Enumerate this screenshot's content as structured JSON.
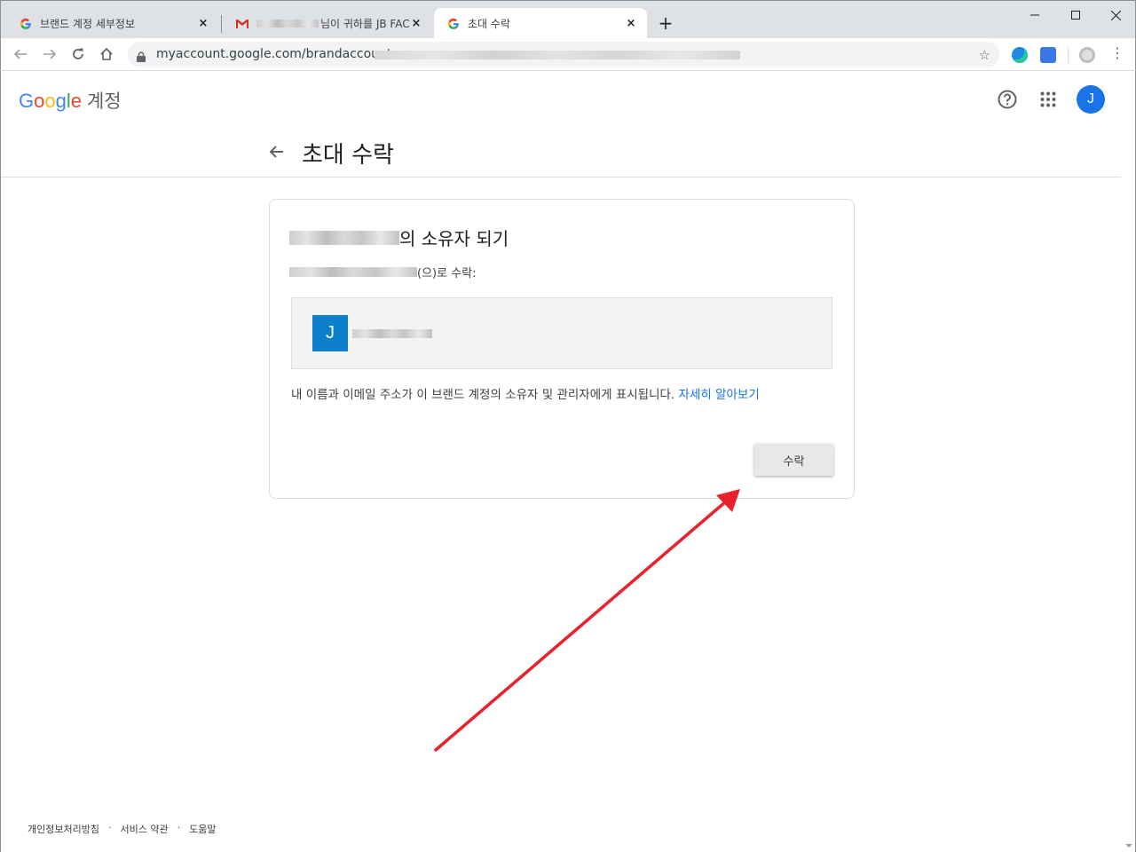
{
  "browser": {
    "tabs": [
      {
        "label": "브랜드 계정 세부정보",
        "icon": "google-g-icon",
        "active": false
      },
      {
        "label": "님이 귀하를 JB FAC",
        "icon": "gmail-icon",
        "active": false
      },
      {
        "label": "초대 수락",
        "icon": "google-g-icon",
        "active": true
      }
    ],
    "close_symbol": "×",
    "new_tab_symbol": "+",
    "url": "myaccount.google.com/brandaccounts"
  },
  "header": {
    "logo_letters": [
      "G",
      "o",
      "o",
      "g",
      "l",
      "e"
    ],
    "logo_sub": "계정",
    "avatar_initial": "J",
    "accent": "#1a73e8"
  },
  "main": {
    "title": "초대 수락",
    "card": {
      "title_suffix": "의 소유자 되기",
      "accept_as_suffix": "(으)로 수락:",
      "account_initial": "J",
      "description": "내 이름과 이메일 주소가 이 브랜드 계정의 소유자 및 관리자에게 표시됩니다.",
      "learn_more": "자세히 알아보기",
      "accept_button": "수락"
    }
  },
  "footer": {
    "links": [
      "개인정보처리방침",
      "서비스 약관",
      "도움말"
    ],
    "separator": "·"
  },
  "annotation": {
    "color": "#e8212b"
  }
}
